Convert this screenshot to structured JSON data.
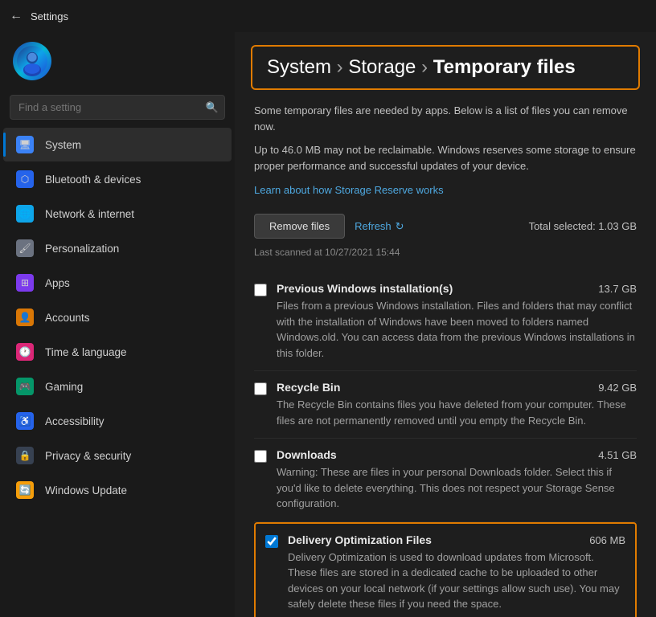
{
  "titleBar": {
    "title": "Settings",
    "backLabel": "←"
  },
  "sidebar": {
    "searchPlaceholder": "Find a setting",
    "searchIcon": "🔍",
    "navItems": [
      {
        "id": "system",
        "label": "System",
        "iconType": "system",
        "active": true,
        "iconSymbol": "🖥"
      },
      {
        "id": "bluetooth",
        "label": "Bluetooth & devices",
        "iconType": "bluetooth",
        "active": false,
        "iconSymbol": "⬡"
      },
      {
        "id": "network",
        "label": "Network & internet",
        "iconType": "network",
        "active": false,
        "iconSymbol": "🌐"
      },
      {
        "id": "personalization",
        "label": "Personalization",
        "iconType": "personalization",
        "active": false,
        "iconSymbol": "🖌"
      },
      {
        "id": "apps",
        "label": "Apps",
        "iconType": "apps",
        "active": false,
        "iconSymbol": "⊞"
      },
      {
        "id": "accounts",
        "label": "Accounts",
        "iconType": "accounts",
        "active": false,
        "iconSymbol": "👤"
      },
      {
        "id": "time",
        "label": "Time & language",
        "iconType": "time",
        "active": false,
        "iconSymbol": "🕐"
      },
      {
        "id": "gaming",
        "label": "Gaming",
        "iconType": "gaming",
        "active": false,
        "iconSymbol": "🎮"
      },
      {
        "id": "accessibility",
        "label": "Accessibility",
        "iconType": "accessibility",
        "active": false,
        "iconSymbol": "♿"
      },
      {
        "id": "privacy",
        "label": "Privacy & security",
        "iconType": "privacy",
        "active": false,
        "iconSymbol": "🔒"
      },
      {
        "id": "update",
        "label": "Windows Update",
        "iconType": "update",
        "active": false,
        "iconSymbol": "🔄"
      }
    ]
  },
  "breadcrumb": {
    "path1": "System",
    "separator1": " › ",
    "path2": "Storage",
    "separator2": " › ",
    "current": "Temporary files"
  },
  "content": {
    "descriptionLine1": "Some temporary files are needed by apps. Below is a list of files you can remove now.",
    "infoLine": "Up to 46.0 MB may not be reclaimable. Windows reserves some storage to ensure proper performance and successful updates of your device.",
    "learnLink": "Learn about how Storage Reserve works",
    "removeButton": "Remove files",
    "refreshButton": "Refresh",
    "totalSelected": "Total selected: 1.03 GB",
    "scanTime": "Last scanned at 10/27/2021 15:44",
    "fileItems": [
      {
        "id": "previous-windows",
        "name": "Previous Windows installation(s)",
        "size": "13.7 GB",
        "description": "Files from a previous Windows installation.  Files and folders that may conflict with the installation of Windows have been moved to folders named Windows.old.  You can access data from the previous Windows installations in this folder.",
        "checked": false,
        "highlighted": false
      },
      {
        "id": "recycle-bin",
        "name": "Recycle Bin",
        "size": "9.42 GB",
        "description": "The Recycle Bin contains files you have deleted from your computer. These files are not permanently removed until you empty the Recycle Bin.",
        "checked": false,
        "highlighted": false
      },
      {
        "id": "downloads",
        "name": "Downloads",
        "size": "4.51 GB",
        "description": "Warning: These are files in your personal Downloads folder. Select this if you'd like to delete everything. This does not respect your Storage Sense configuration.",
        "checked": false,
        "highlighted": false
      },
      {
        "id": "delivery-optimization",
        "name": "Delivery Optimization Files",
        "size": "606 MB",
        "description": "Delivery Optimization is used to download updates from Microsoft. These files are stored in a dedicated cache to be uploaded to other devices on your local network (if your settings allow such use). You may safely delete these files if you need the space.",
        "checked": true,
        "highlighted": true
      }
    ]
  }
}
